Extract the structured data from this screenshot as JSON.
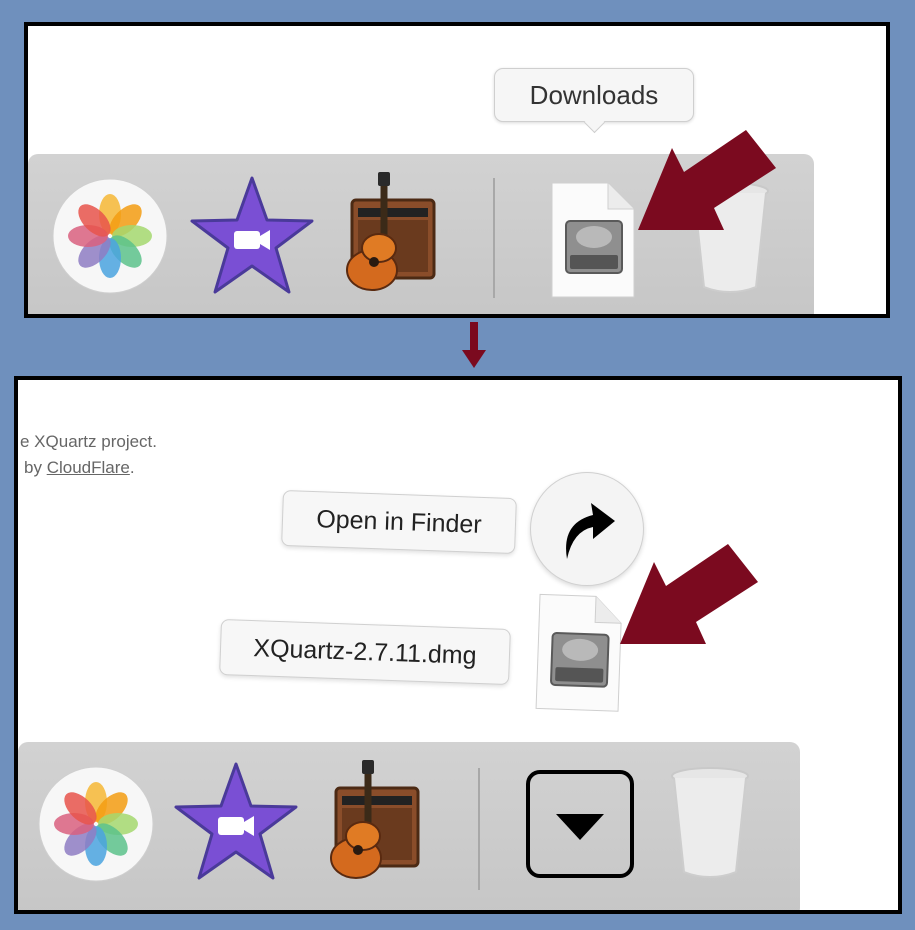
{
  "top_panel": {
    "tooltip": "Downloads"
  },
  "bottom_panel": {
    "web_text_line1": "e XQuartz project.",
    "web_text_line2_prefix": "by ",
    "web_text_link": "CloudFlare",
    "web_text_line2_suffix": ".",
    "open_in_finder_label": "Open in Finder",
    "file_label": "XQuartz-2.7.11.dmg"
  },
  "dock_icons": [
    "photos-icon",
    "imovie-icon",
    "garageband-icon",
    "downloads-stack-icon",
    "trash-icon"
  ],
  "colors": {
    "background": "#6f90bd",
    "annotation_arrow": "#7b0a1f",
    "dock": "#cacaca"
  }
}
